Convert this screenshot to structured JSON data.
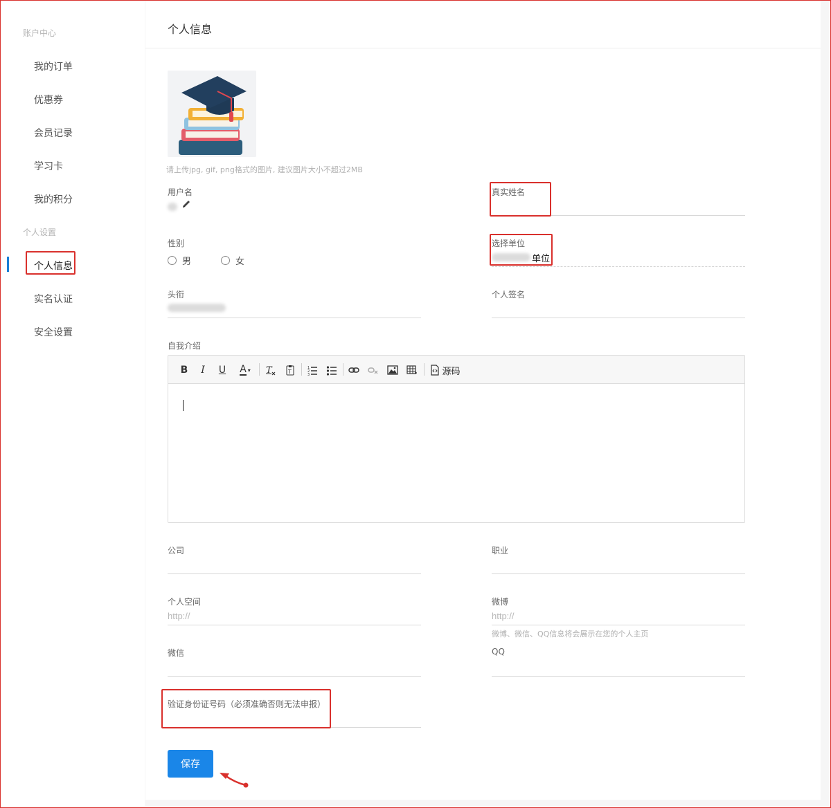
{
  "sidebar": {
    "group_account": "账户中心",
    "account_items": [
      {
        "label": "我的订单"
      },
      {
        "label": "优惠券"
      },
      {
        "label": "会员记录"
      },
      {
        "label": "学习卡"
      },
      {
        "label": "我的积分"
      }
    ],
    "group_personal": "个人设置",
    "personal_items": [
      {
        "label": "个人信息",
        "active": true
      },
      {
        "label": "实名认证"
      },
      {
        "label": "安全设置"
      }
    ]
  },
  "header": {
    "title": "个人信息"
  },
  "avatar": {
    "hint": "请上传jpg, gif, png格式的图片, 建议图片大小不超过2MB"
  },
  "form": {
    "username_label": "用户名",
    "realname_label": "真实姓名",
    "gender_label": "性别",
    "gender_options": [
      "男",
      "女"
    ],
    "unit_label": "选择单位",
    "unit_value_suffix": "单位",
    "title_label": "头衔",
    "signature_label": "个人签名",
    "intro_label": "自我介绍",
    "company_label": "公司",
    "job_label": "职业",
    "space_label": "个人空间",
    "space_placeholder": "http://",
    "weibo_label": "微博",
    "weibo_placeholder": "http://",
    "social_hint": "微博、微信、QQ信息将会展示在您的个人主页",
    "wechat_label": "微信",
    "qq_label": "QQ",
    "idcard_label": "验证身份证号码（必须准确否则无法申报）"
  },
  "editor": {
    "toolbar": {
      "bold": "B",
      "italic": "I",
      "underline": "U",
      "font_color": "A",
      "source_label": "源码"
    }
  },
  "actions": {
    "save_label": "保存"
  },
  "colors": {
    "primary": "#1a86e8",
    "annotation": "#d9302c",
    "active_bar": "#1a7fd6"
  }
}
